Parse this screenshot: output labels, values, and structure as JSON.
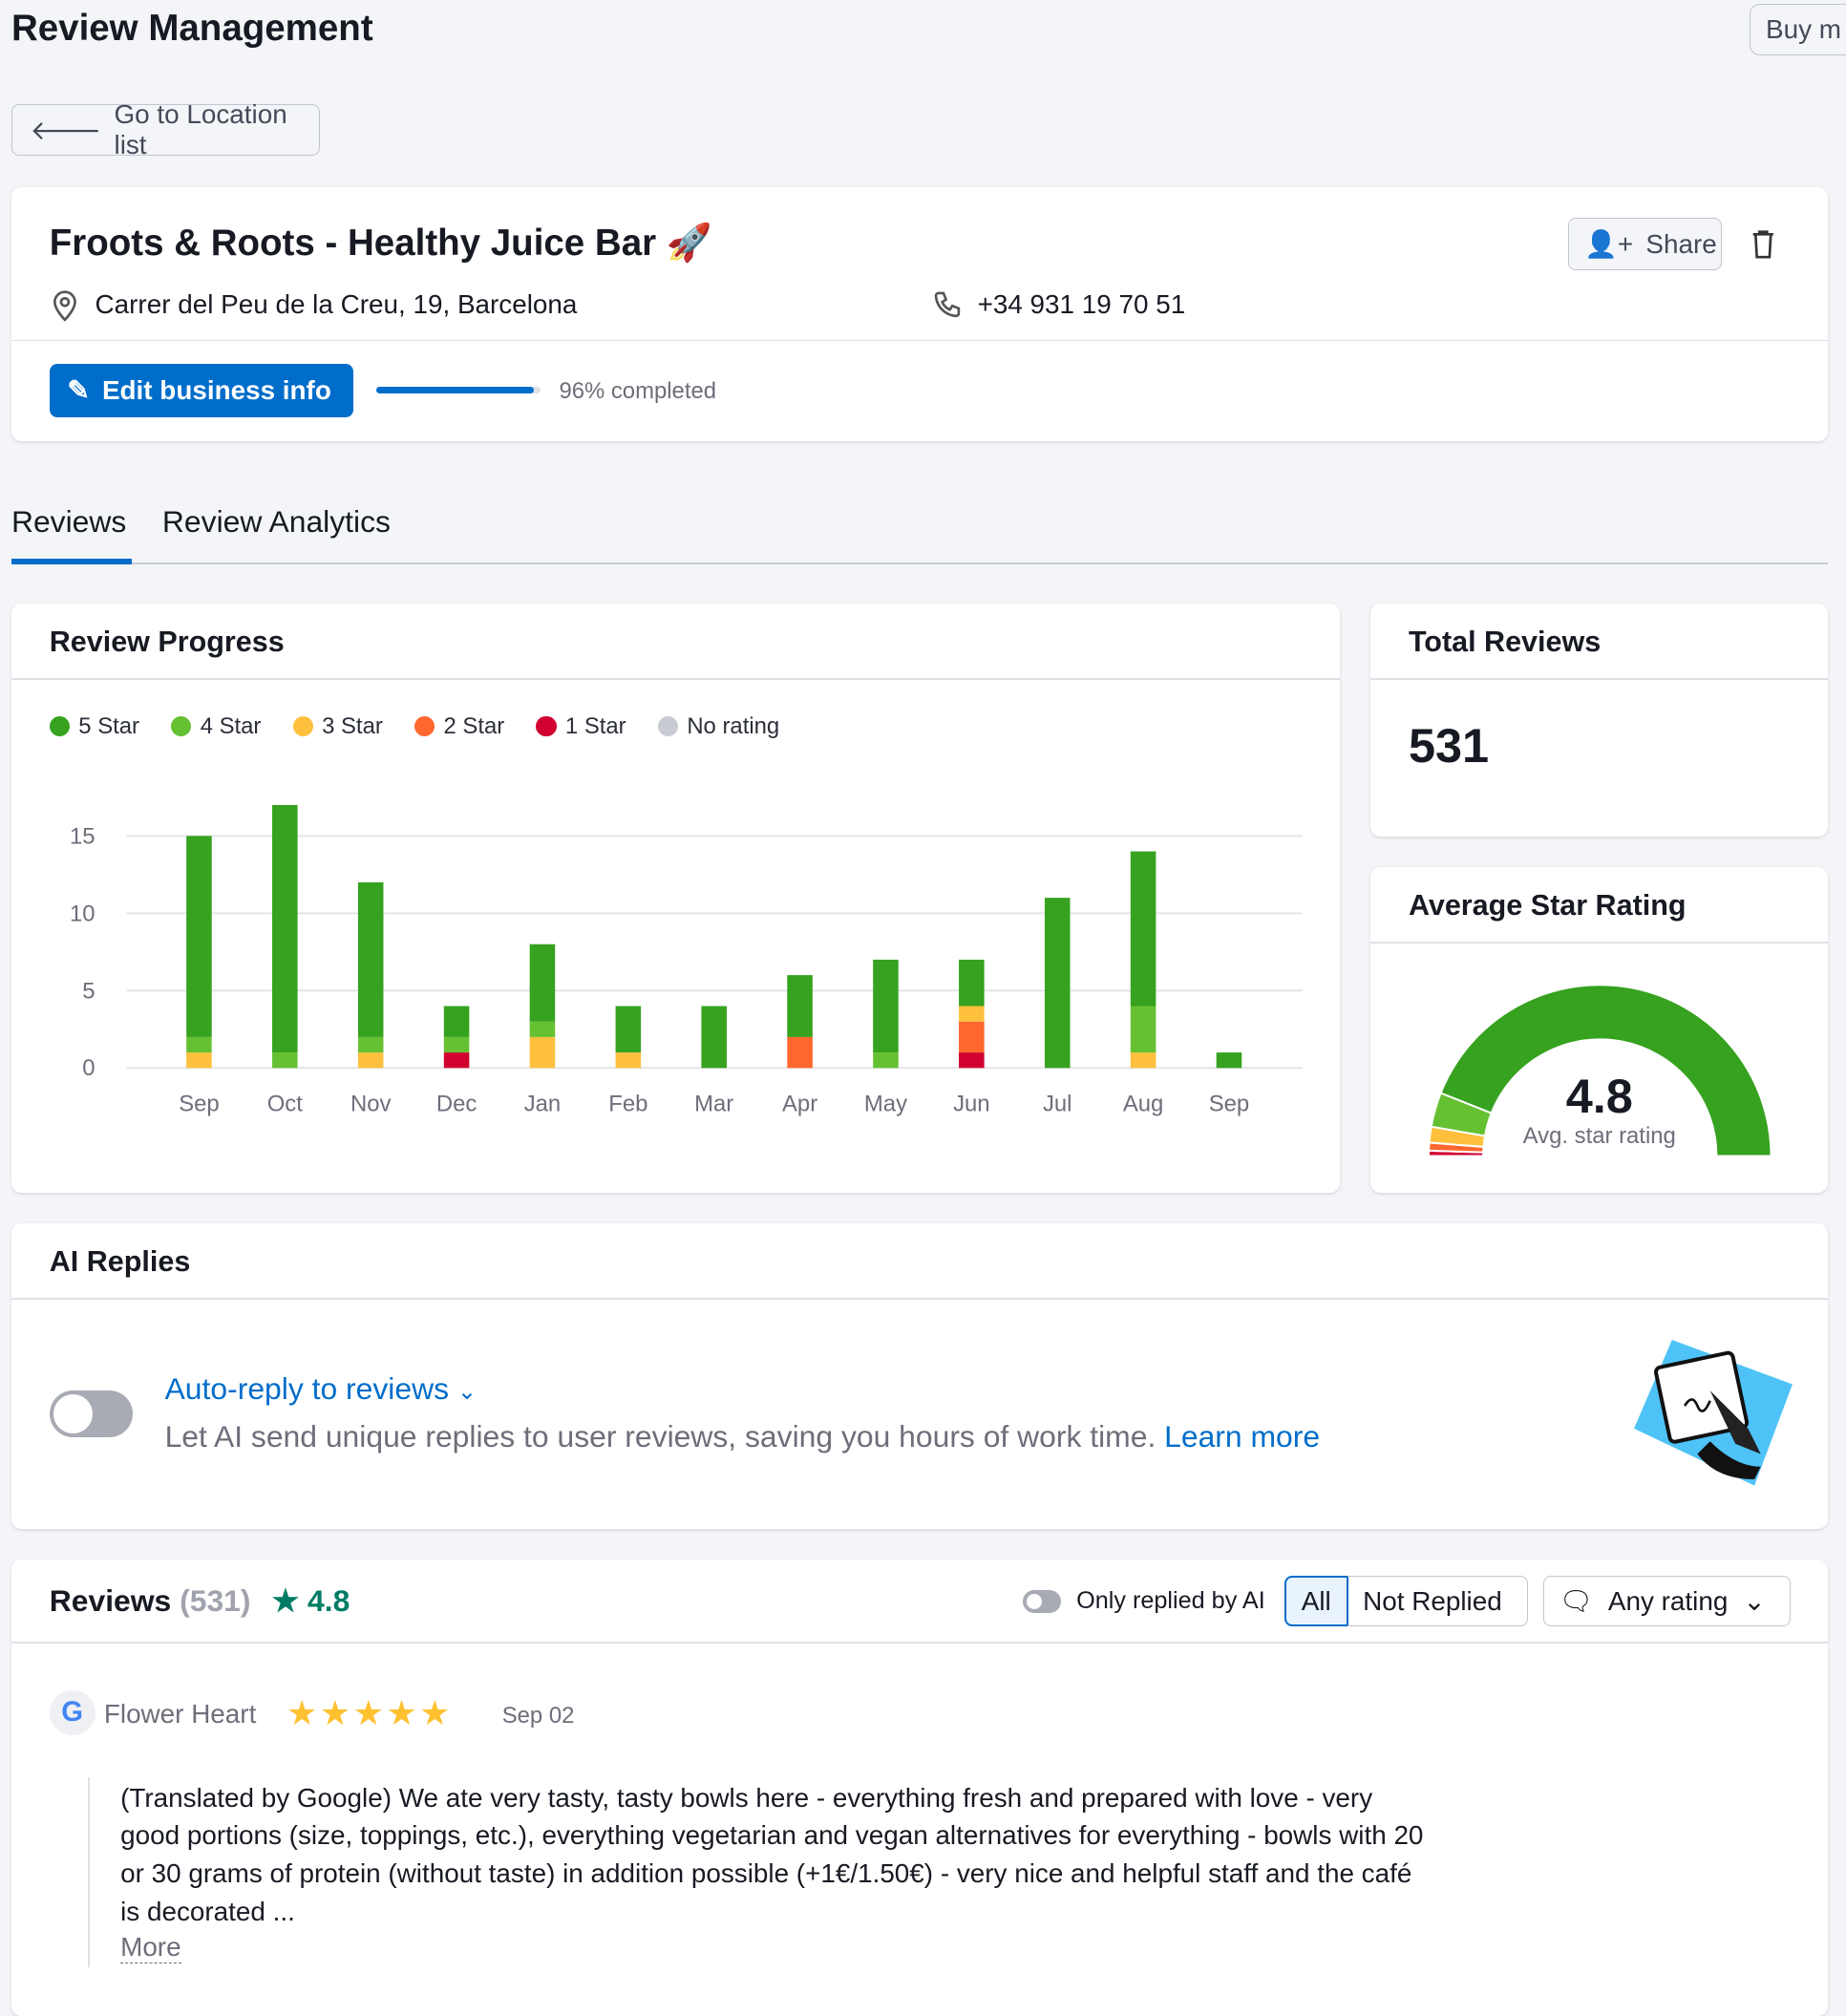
{
  "page": {
    "title": "Review Management",
    "buy_label": "Buy m",
    "back_label": "Go to Location list"
  },
  "business": {
    "name": "Froots & Roots - Healthy Juice Bar",
    "emoji": "🚀",
    "address": "Carrer del Peu de la Creu, 19, Barcelona",
    "phone": "+34 931 19 70 51",
    "share_label": "Share",
    "edit_label": "Edit business info",
    "completion_percent": 96,
    "completion_text": "96% completed"
  },
  "tabs": [
    {
      "label": "Reviews",
      "active": true
    },
    {
      "label": "Review Analytics",
      "active": false
    }
  ],
  "progress": {
    "title": "Review Progress"
  },
  "colors": {
    "5": "#36a21f",
    "4": "#66c132",
    "3": "#fec03d",
    "2": "#ff672e",
    "1": "#d1002f",
    "none": "#c9cbd3",
    "accent": "#006dca"
  },
  "chart_data": {
    "type": "bar",
    "stacked": true,
    "categories": [
      "Sep",
      "Oct",
      "Nov",
      "Dec",
      "Jan",
      "Feb",
      "Mar",
      "Apr",
      "May",
      "Jun",
      "Jul",
      "Aug",
      "Sep"
    ],
    "yticks": [
      0,
      5,
      10,
      15
    ],
    "ylim": [
      0,
      17
    ],
    "grid": true,
    "legend_placement": "top-left",
    "series": [
      {
        "name": "5 Star",
        "key": "5",
        "values": [
          13,
          16,
          10,
          2,
          5,
          3,
          4,
          4,
          6,
          3,
          11,
          10,
          1
        ]
      },
      {
        "name": "4 Star",
        "key": "4",
        "values": [
          1,
          1,
          1,
          1,
          1,
          0,
          0,
          0,
          1,
          0,
          0,
          3,
          0
        ]
      },
      {
        "name": "3 Star",
        "key": "3",
        "values": [
          1,
          0,
          1,
          0,
          2,
          1,
          0,
          0,
          0,
          1,
          0,
          1,
          0
        ]
      },
      {
        "name": "2 Star",
        "key": "2",
        "values": [
          0,
          0,
          0,
          0,
          0,
          0,
          0,
          2,
          0,
          2,
          0,
          0,
          0
        ]
      },
      {
        "name": "1 Star",
        "key": "1",
        "values": [
          0,
          0,
          0,
          1,
          0,
          0,
          0,
          0,
          0,
          1,
          0,
          0,
          0
        ]
      },
      {
        "name": "No rating",
        "key": "none",
        "values": [
          0,
          0,
          0,
          0,
          0,
          0,
          0,
          0,
          0,
          0,
          0,
          0,
          0
        ]
      }
    ]
  },
  "total": {
    "title": "Total Reviews",
    "value": "531"
  },
  "average": {
    "title": "Average Star Rating",
    "value": "4.8",
    "label": "Avg. star rating",
    "distribution_percent": {
      "1": 1,
      "2": 1.5,
      "3": 3,
      "4": 6.5,
      "5": 88
    }
  },
  "ai": {
    "title": "AI Replies",
    "enabled": false,
    "link_label": "Auto-reply to reviews",
    "description": "Let AI send unique replies to user reviews, saving you hours of work time.",
    "learn_more": "Learn more"
  },
  "reviews": {
    "title": "Reviews",
    "count": "(531)",
    "rating": "4.8",
    "only_ai_label": "Only replied by AI",
    "filter_all": "All",
    "filter_not_replied": "Not Replied",
    "rating_filter": "Any rating",
    "items": [
      {
        "author": "Flower Heart",
        "source": "google",
        "stars": 5,
        "date": "Sep 02",
        "text": "(Translated by Google) We ate very tasty, tasty bowls here - everything fresh and prepared with love - very good portions (size, toppings, etc.), everything vegetarian and vegan alternatives for everything - bowls with 20 or 30 grams of protein (without taste) in addition possible (+1€/1.50€) - very nice and helpful staff and the café is decorated ...",
        "more": "More"
      }
    ]
  }
}
